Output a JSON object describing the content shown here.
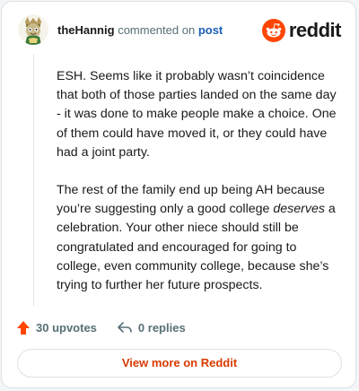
{
  "comment": {
    "author": "theHannig",
    "action_text": "commented on",
    "link_text": "post",
    "paragraph_1": "ESH. Seems like it probably wasn’t coincidence that both of those parties landed on the same day - it was done to make people make a choice. One of them could have moved it, or they could have had a joint party.",
    "paragraph_2_before": "The rest of the family end up being AH because you’re suggesting only a good college ",
    "paragraph_2_emphasis": "deserves",
    "paragraph_2_after": " a celebration. Your other niece should still be congratulated and encouraged for going to college, even community college, because she’s trying to further her future prospects."
  },
  "brand": {
    "name": "reddit",
    "color": "#ff4500"
  },
  "footer": {
    "upvotes_label": "30 upvotes",
    "replies_label": "0 replies",
    "upvote_icon": "upvote-arrow-icon",
    "reply_icon": "reply-icon"
  },
  "cta": {
    "label": "View more on Reddit"
  }
}
